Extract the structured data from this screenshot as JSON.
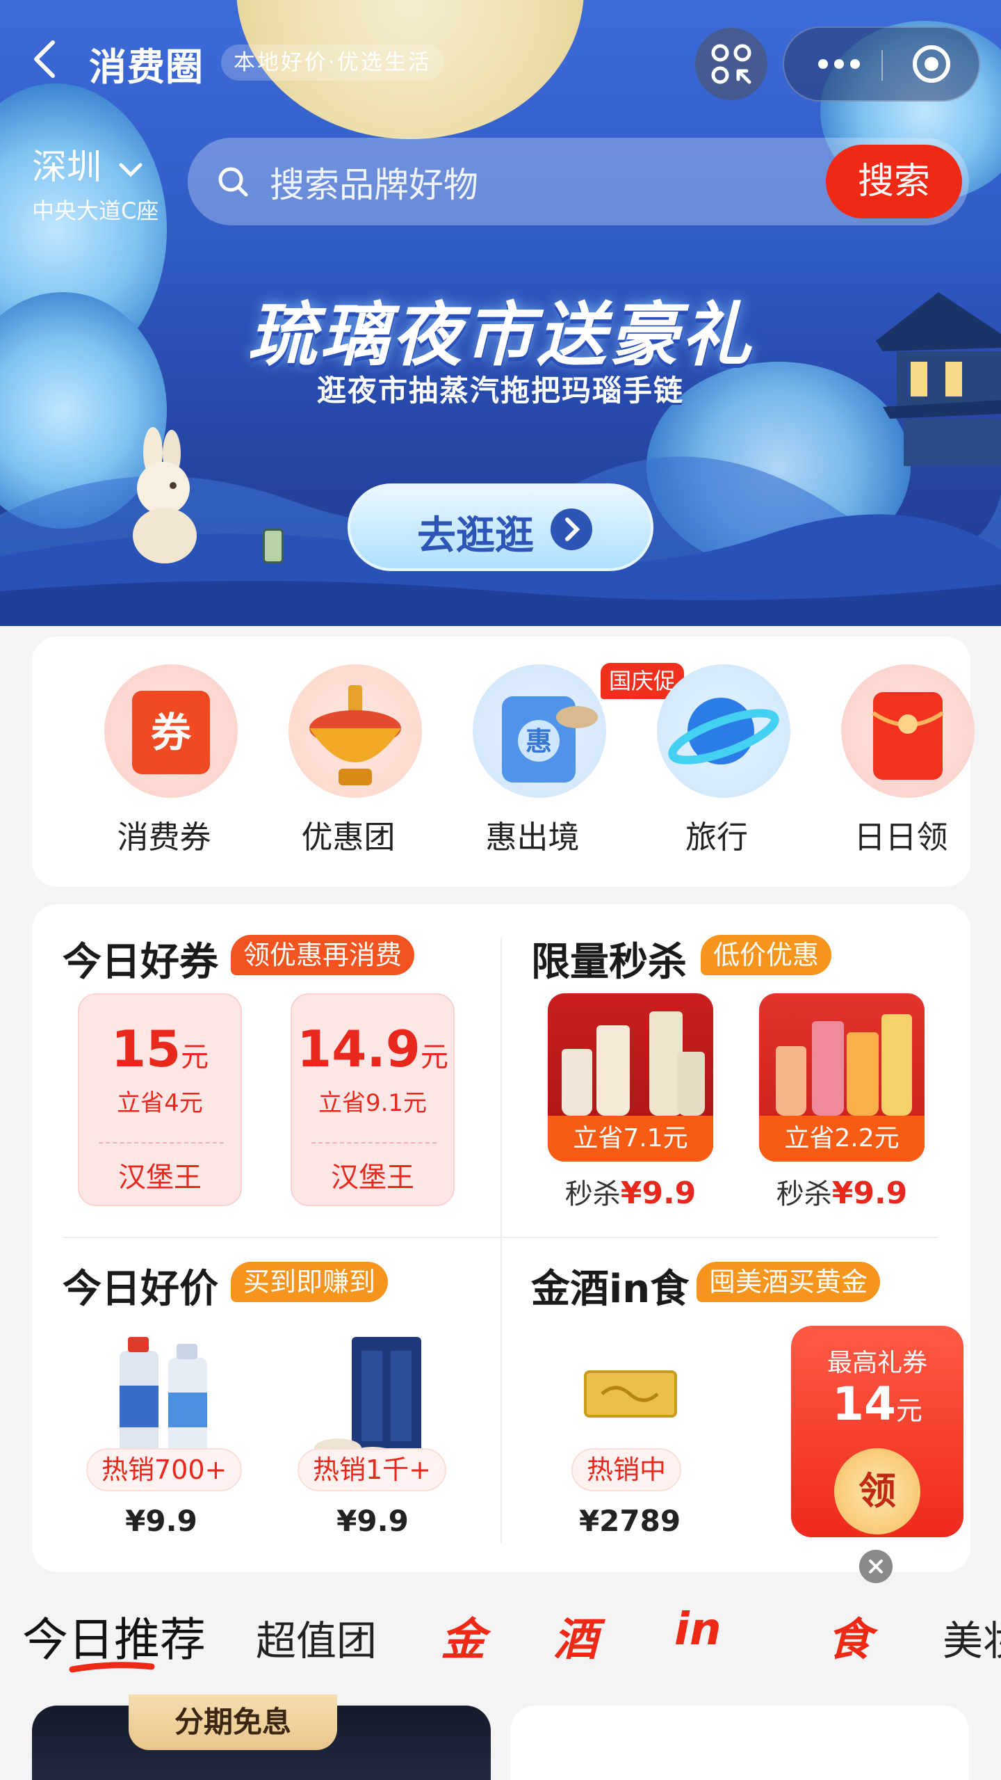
{
  "header": {
    "app_title": "消费圈",
    "app_subtitle": "本地好价·优选生活",
    "city": "深圳",
    "address": "中央大道C座",
    "search_placeholder": "搜索品牌好物",
    "search_button": "搜索"
  },
  "banner": {
    "title": "琉璃夜市送豪礼",
    "subtitle": "逛夜市抽蒸汽拖把玛瑙手链",
    "button": "去逛逛"
  },
  "quick_icons": [
    {
      "label": "消费券",
      "icon": "coupon-ticket-icon"
    },
    {
      "label": "优惠团",
      "icon": "hotpot-icon"
    },
    {
      "label": "惠出境",
      "icon": "suitcase-icon",
      "badge": "国庆促"
    },
    {
      "label": "旅行",
      "icon": "planet-icon"
    },
    {
      "label": "日日领",
      "icon": "red-envelope-icon"
    }
  ],
  "deals": {
    "coupons": {
      "title": "今日好券",
      "tag": "领优惠再消费",
      "items": [
        {
          "amount": "15",
          "unit": "元",
          "save": "立省4元",
          "brand": "汉堡王"
        },
        {
          "amount": "14.9",
          "unit": "元",
          "save": "立省9.1元",
          "brand": "汉堡王"
        }
      ]
    },
    "flash": {
      "title": "限量秒杀",
      "tag": "低价优惠",
      "items": [
        {
          "save": "立省7.1元",
          "label": "秒杀",
          "price": "¥9.9"
        },
        {
          "save": "立省2.2元",
          "label": "秒杀",
          "price": "¥9.9"
        }
      ]
    },
    "prices": {
      "title": "今日好价",
      "tag": "买到即赚到",
      "items": [
        {
          "hot": "热销700+",
          "price": "¥9.9"
        },
        {
          "hot": "热销1千+",
          "price": "¥9.9"
        }
      ]
    },
    "liquor": {
      "title": "金酒in食",
      "tag": "囤美酒买黄金",
      "items": [
        {
          "hot": "热销中",
          "price": "¥2789"
        }
      ]
    }
  },
  "gift_popup": {
    "top": "最高礼券",
    "amount": "14",
    "unit": "元",
    "seal": "领"
  },
  "tabs": [
    "今日推荐",
    "超值团",
    "金",
    "酒",
    "in",
    "食",
    "美妆"
  ],
  "bottom": {
    "card_tag": "分期免息"
  },
  "colors": {
    "accent_red": "#ee2a16",
    "tag_orange": "#f6941c",
    "tag_red": "#f2531f"
  }
}
